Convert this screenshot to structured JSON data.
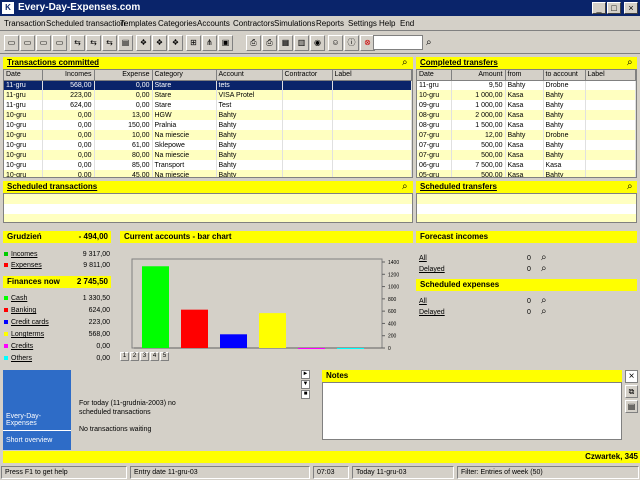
{
  "window": {
    "title": "Every-Day-Expenses.com",
    "icon": "K"
  },
  "menu": [
    "Transaction",
    "Scheduled transaction",
    "Templates",
    "Categories",
    "Accounts",
    "Contractors",
    "Simulations",
    "Reports",
    "Settings",
    "Help",
    "End"
  ],
  "toolbar": {
    "search_value": ""
  },
  "transactions": {
    "title": "Transactions committed",
    "columns": [
      "Date",
      "Incomes",
      "Expense",
      "Category",
      "Account",
      "Contractor",
      "Label"
    ],
    "rows": [
      [
        "11-gru",
        "568,00",
        "0,00",
        "Stare",
        "tets",
        "",
        ""
      ],
      [
        "11-gru",
        "223,00",
        "0,00",
        "Stare",
        "VISA Protel",
        "",
        ""
      ],
      [
        "11-gru",
        "624,00",
        "0,00",
        "Stare",
        "Test",
        "",
        ""
      ],
      [
        "10-gru",
        "0,00",
        "13,00",
        "HGW",
        "Bahty",
        "",
        ""
      ],
      [
        "10-gru",
        "0,00",
        "150,00",
        "Pralnia",
        "Bahty",
        "",
        ""
      ],
      [
        "10-gru",
        "0,00",
        "10,00",
        "Na miescie",
        "Bahty",
        "",
        ""
      ],
      [
        "10-gru",
        "0,00",
        "61,00",
        "Sklepowe",
        "Bahty",
        "",
        ""
      ],
      [
        "10-gru",
        "0,00",
        "80,00",
        "Na miescie",
        "Bahty",
        "",
        ""
      ],
      [
        "10-gru",
        "0,00",
        "85,00",
        "Transport",
        "Bahty",
        "",
        ""
      ],
      [
        "10-gru",
        "0,00",
        "45,00",
        "Na miescie",
        "Bahty",
        "",
        ""
      ]
    ]
  },
  "transfers": {
    "title": "Completed transfers",
    "columns": [
      "Date",
      "Amount",
      "from",
      "to account",
      "Label"
    ],
    "rows": [
      [
        "11-gru",
        "9,50",
        "Bahty",
        "Drobne",
        ""
      ],
      [
        "10-gru",
        "1 000,00",
        "Kasa",
        "Bahty",
        ""
      ],
      [
        "09-gru",
        "1 000,00",
        "Kasa",
        "Bahty",
        ""
      ],
      [
        "08-gru",
        "2 000,00",
        "Kasa",
        "Bahty",
        ""
      ],
      [
        "08-gru",
        "1 500,00",
        "Kasa",
        "Bahty",
        ""
      ],
      [
        "07-gru",
        "12,00",
        "Bahty",
        "Drobne",
        ""
      ],
      [
        "07-gru",
        "500,00",
        "Kasa",
        "Bahty",
        ""
      ],
      [
        "07-gru",
        "500,00",
        "Kasa",
        "Bahty",
        ""
      ],
      [
        "06-gru",
        "7 500,00",
        "Kasa",
        "Kasa",
        ""
      ],
      [
        "05-gru",
        "500,00",
        "Kasa",
        "Bahty",
        ""
      ]
    ]
  },
  "scheduled_transactions": {
    "title": "Scheduled transactions"
  },
  "scheduled_transfers": {
    "title": "Scheduled transfers"
  },
  "month_summary": {
    "month": "Grudzień",
    "balance": "- 494,00",
    "items": [
      {
        "label": "Incomes",
        "value": "9 317,00",
        "color": "#00cc00"
      },
      {
        "label": "Expenses",
        "value": "9 811,00",
        "color": "#ff0000"
      }
    ]
  },
  "finances": {
    "title": "Finances now",
    "total": "2 745,50",
    "items": [
      {
        "label": "Cash",
        "value": "1 330,50",
        "color": "#00ff00"
      },
      {
        "label": "Banking",
        "value": "624,00",
        "color": "#ff0000"
      },
      {
        "label": "Credit cards",
        "value": "223,00",
        "color": "#0000ff"
      },
      {
        "label": "Longterms",
        "value": "568,00",
        "color": "#ffff00"
      },
      {
        "label": "Credits",
        "value": "0,00",
        "color": "#ff00ff"
      },
      {
        "label": "Others",
        "value": "0,00",
        "color": "#00ffff"
      }
    ]
  },
  "chart_panel": {
    "title": "Current accounts - bar chart",
    "pages": [
      "1",
      "2",
      "3",
      "4",
      "5"
    ]
  },
  "chart_data": {
    "type": "bar",
    "categories": [
      "Cash",
      "Banking",
      "Credit cards",
      "Longterms",
      "Credits",
      "Others"
    ],
    "values": [
      1330.5,
      624,
      223,
      568,
      0,
      0
    ],
    "colors": [
      "#00ff00",
      "#ff0000",
      "#0000ff",
      "#ffff00",
      "#ff00ff",
      "#00ffff"
    ],
    "yticks": [
      0,
      200,
      400,
      600,
      800,
      1000,
      1200,
      1400
    ],
    "ylim": [
      0,
      1400
    ]
  },
  "forecast": {
    "title": "Forecast incomes",
    "items": [
      {
        "label": "All",
        "value": "0"
      },
      {
        "label": "Delayed",
        "value": "0"
      }
    ]
  },
  "scheduled_expenses": {
    "title": "Scheduled expenses",
    "items": [
      {
        "label": "All",
        "value": "0"
      },
      {
        "label": "Delayed",
        "value": "0"
      }
    ]
  },
  "overview": {
    "brand": "Every-Day-Expenses",
    "tab": "Short overview",
    "today_text": "For today (11-grudnia-2003) no scheduled transactions",
    "waiting_text": "No transactions waiting"
  },
  "notes": {
    "title": "Notes",
    "content": ""
  },
  "date_bar": "Czwartek, 345",
  "status": {
    "help": "Press F1 to get help",
    "entry_date": "Entry date 11-gru-03",
    "time": "07:03",
    "today": "Today 11-gru-03",
    "filter": "Filter: Entries of  week (50)"
  }
}
